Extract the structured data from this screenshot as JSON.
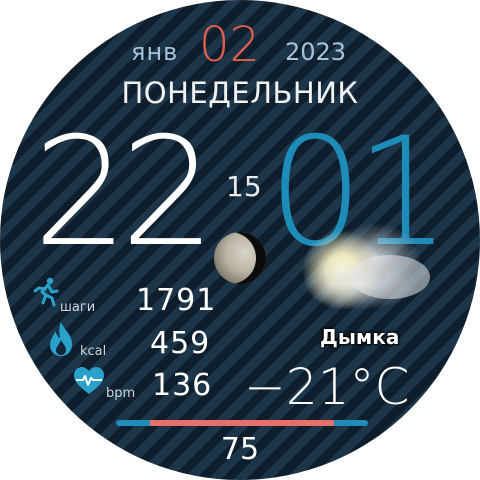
{
  "date": {
    "month": "янв",
    "day": "02",
    "year": "2023",
    "weekday": "ПОНЕДЕЛЬНИК"
  },
  "time": {
    "hours": "22",
    "minutes": "01",
    "seconds": "15"
  },
  "stats": {
    "steps": {
      "label": "шаги",
      "value": "1791",
      "icon": "running-person-icon"
    },
    "calories": {
      "label": "kcal",
      "value": "459",
      "icon": "flame-icon"
    },
    "heart": {
      "label": "bpm",
      "value": "136",
      "icon": "heart-rate-icon"
    }
  },
  "weather": {
    "condition": "Дымка",
    "temperature": "−21°C",
    "icon": "haze-sun-icon"
  },
  "moon": {
    "icon": "moon-phase-icon"
  },
  "progress": {
    "value": "75",
    "fraction": 0.75
  },
  "colors": {
    "accent_red": "#e0604d",
    "accent_blue": "#1e8cb8",
    "date_gray": "#a6c2dc",
    "stat_icon_blue": "#2aa0cc"
  }
}
